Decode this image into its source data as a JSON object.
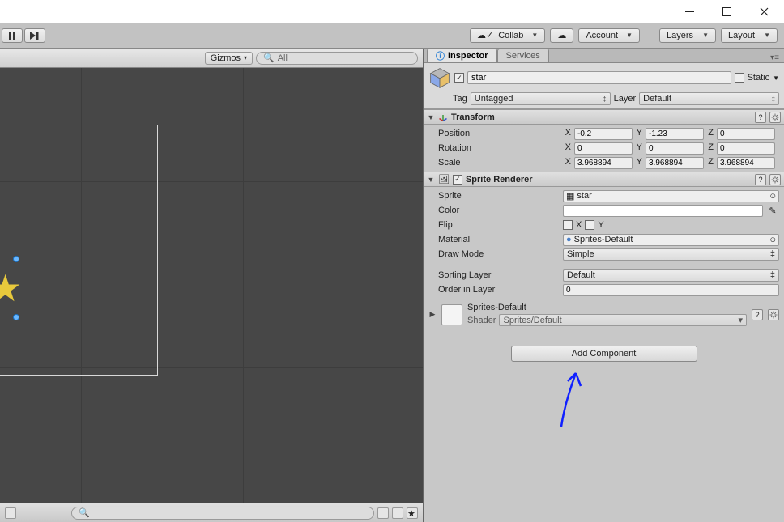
{
  "toolbar": {
    "collab": "Collab",
    "account": "Account",
    "layers": "Layers",
    "layout": "Layout"
  },
  "scene": {
    "gizmos": "Gizmos",
    "search_placeholder": "All"
  },
  "tabs": {
    "inspector": "Inspector",
    "services": "Services"
  },
  "header": {
    "name": "star",
    "static_label": "Static",
    "tag_label": "Tag",
    "tag_value": "Untagged",
    "layer_label": "Layer",
    "layer_value": "Default"
  },
  "transform": {
    "title": "Transform",
    "pos_label": "Position",
    "rot_label": "Rotation",
    "scale_label": "Scale",
    "pos": {
      "x": "-0.2",
      "y": "-1.23",
      "z": "0"
    },
    "rot": {
      "x": "0",
      "y": "0",
      "z": "0"
    },
    "scale": {
      "x": "3.968894",
      "y": "3.968894",
      "z": "3.968894"
    }
  },
  "sprite_renderer": {
    "title": "Sprite Renderer",
    "sprite_label": "Sprite",
    "sprite_value": "star",
    "color_label": "Color",
    "flip_label": "Flip",
    "flip_x": "X",
    "flip_y": "Y",
    "material_label": "Material",
    "material_value": "Sprites-Default",
    "drawmode_label": "Draw Mode",
    "drawmode_value": "Simple",
    "sortlayer_label": "Sorting Layer",
    "sortlayer_value": "Default",
    "order_label": "Order in Layer",
    "order_value": "0"
  },
  "material": {
    "name": "Sprites-Default",
    "shader_label": "Shader",
    "shader_value": "Sprites/Default"
  },
  "add_component": "Add Component"
}
